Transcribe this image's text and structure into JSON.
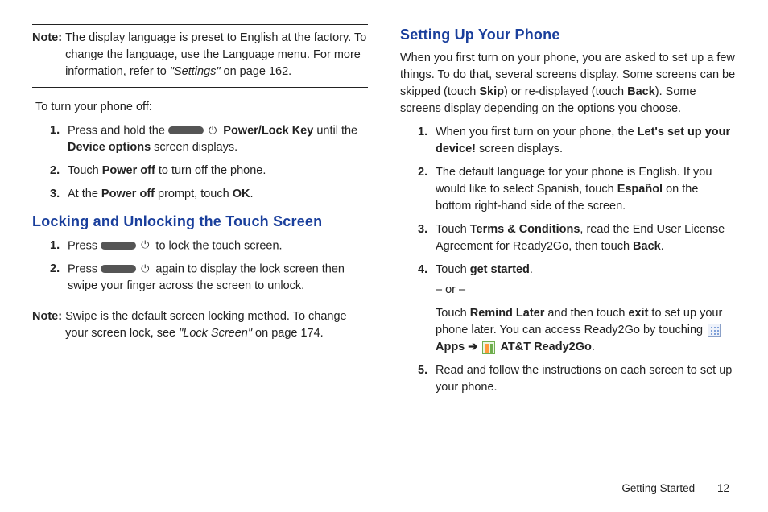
{
  "left": {
    "note1": {
      "label": "Note:",
      "text_a": "The display language is preset to English at the factory. To change the language, use the Language menu. For more information, refer to ",
      "text_ital": "\"Settings\"",
      "text_b": " on page 162."
    },
    "turnoff_lead": "To turn your phone off:",
    "turnoff": {
      "s1a": "Press and hold the ",
      "s1b": " Power/Lock Key",
      "s1c": " until the ",
      "s1d": "Device options",
      "s1e": " screen displays.",
      "s2a": "Touch ",
      "s2b": "Power off",
      "s2c": " to turn off the phone.",
      "s3a": "At the ",
      "s3b": "Power off",
      "s3c": " prompt, touch ",
      "s3d": "OK",
      "s3e": "."
    },
    "heading_lock": "Locking and Unlocking the Touch Screen",
    "lock": {
      "s1a": "Press ",
      "s1b": " to lock the touch screen.",
      "s2a": "Press ",
      "s2b": " again to display the lock screen then swipe your finger across the screen to unlock."
    },
    "note2": {
      "label": "Note:",
      "text_a": "Swipe is the default screen locking method. To change your screen lock, see ",
      "text_ital": "\"Lock Screen\"",
      "text_b": " on page 174."
    }
  },
  "right": {
    "heading_setup": "Setting Up Your Phone",
    "intro_a": "When you first turn on your phone, you are asked to set up a few things. To do that, several screens display. Some screens can be skipped (touch ",
    "intro_b": "Skip",
    "intro_c": ") or re-displayed (touch ",
    "intro_d": "Back",
    "intro_e": "). Some screens display depending on the options you choose.",
    "steps": {
      "s1a": "When you first turn on your phone, the ",
      "s1b": "Let's set up your device!",
      "s1c": " screen displays.",
      "s2a": "The default language for your phone is English. If you would like to select Spanish, touch ",
      "s2b": "Español",
      "s2c": " on the bottom right-hand side of the screen.",
      "s3a": "Touch ",
      "s3b": "Terms & Conditions",
      "s3c": ", read the End User License Agreement for Ready2Go, then touch ",
      "s3d": "Back",
      "s3e": ".",
      "s4a": "Touch ",
      "s4b": "get started",
      "s4c": ".",
      "s4_or": "– or –",
      "s4d": "Touch ",
      "s4e": "Remind Later",
      "s4f": " and then touch ",
      "s4g": "exit",
      "s4h": " to set up your phone later. You can access Ready2Go by touching ",
      "s4_apps": "Apps",
      "s4_arrow": "➔",
      "s4_r2g": "AT&T Ready2Go",
      "s4i": ".",
      "s5": "Read and follow the instructions on each screen to set up your phone."
    }
  },
  "footer": {
    "section": "Getting Started",
    "page": "12"
  }
}
